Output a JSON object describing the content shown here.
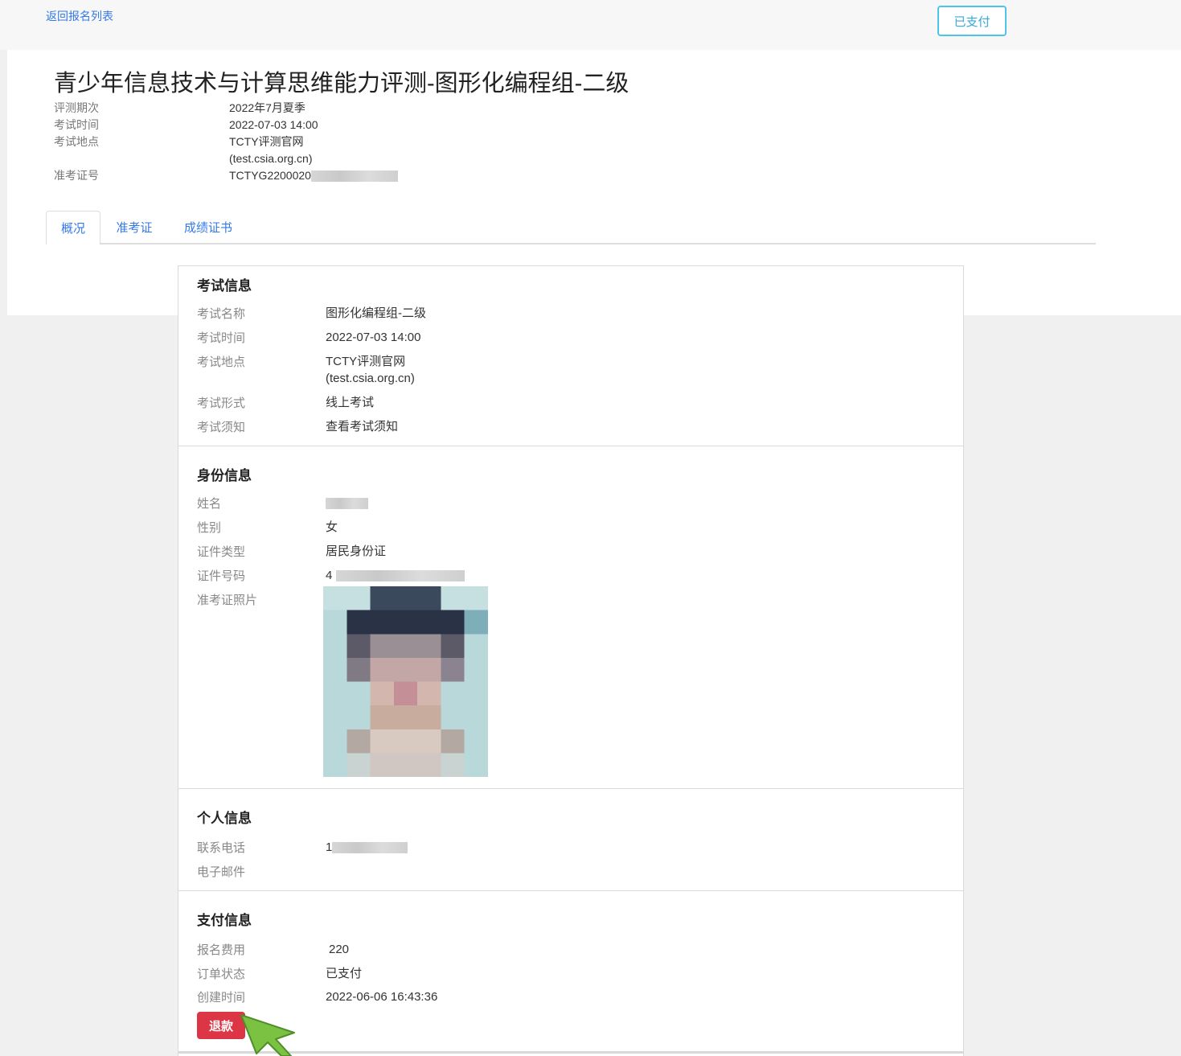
{
  "header": {
    "back_link": "返回报名列表",
    "status_button": "已支付"
  },
  "exam": {
    "title": "青少年信息技术与计算思维能力评测-图形化编程组-二级",
    "meta": {
      "batch_label": "评测期次",
      "batch_value": "2022年7月夏季",
      "time_label": "考试时间",
      "time_value": "2022-07-03 14:00",
      "location_label": "考试地点",
      "location_value_1": "TCTY评测官网",
      "location_value_2": "(test.csia.org.cn)",
      "ticket_label": "准考证号",
      "ticket_value": "TCTYG2200020"
    }
  },
  "tabs": [
    {
      "label": "概况",
      "active": true
    },
    {
      "label": "准考证",
      "active": false
    },
    {
      "label": "成绩证书",
      "active": false
    }
  ],
  "sections": {
    "exam_info": {
      "heading": "考试信息",
      "name_label": "考试名称",
      "name_value": "图形化编程组-二级",
      "time_label": "考试时间",
      "time_value": "2022-07-03 14:00",
      "location_label": "考试地点",
      "location_value_1": "TCTY评测官网",
      "location_value_2": "(test.csia.org.cn)",
      "format_label": "考试形式",
      "format_value": "线上考试",
      "notice_label": "考试须知",
      "notice_link": "查看考试须知"
    },
    "identity": {
      "heading": "身份信息",
      "name_label": "姓名",
      "gender_label": "性别",
      "gender_value": "女",
      "id_type_label": "证件类型",
      "id_type_value": "居民身份证",
      "id_number_label": "证件号码",
      "id_number_value": "4",
      "photo_label": "准考证照片"
    },
    "personal": {
      "heading": "个人信息",
      "phone_label": "联系电话",
      "phone_value": "1",
      "email_label": "电子邮件"
    },
    "payment": {
      "heading": "支付信息",
      "fee_label": "报名费用",
      "fee_value": "220",
      "status_label": "订单状态",
      "status_value": "已支付",
      "created_label": "创建时间",
      "created_value": "2022-06-06 16:43:36",
      "refund_button": "退款"
    }
  },
  "colors": {
    "link": "#3478e6",
    "refund": "#dc3545",
    "paid_border": "#4fc3e8",
    "cursor": "#7cc242"
  }
}
